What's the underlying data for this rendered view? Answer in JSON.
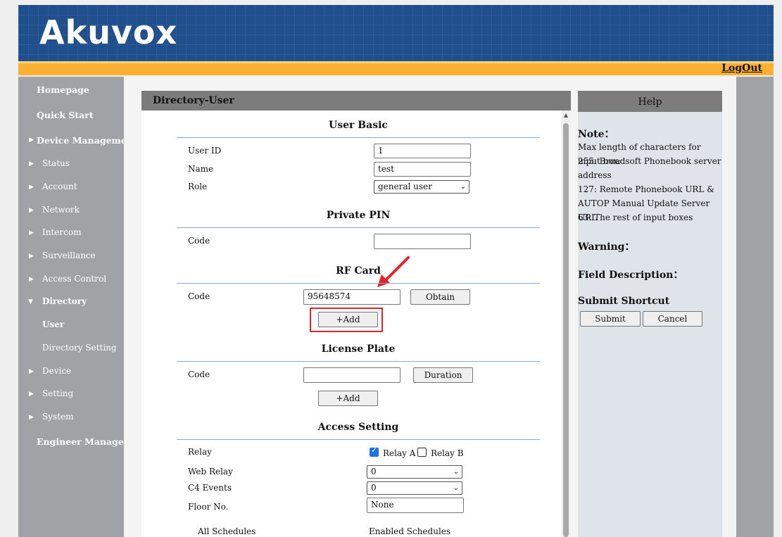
{
  "brand": {
    "logo_text": "Akuvox"
  },
  "topbar": {
    "logout_label": "LogOut"
  },
  "sidebar": {
    "homepage": "Homepage",
    "quick_start": "Quick Start",
    "device_management": "Device Management",
    "status": "Status",
    "account": "Account",
    "network": "Network",
    "intercom": "Intercom",
    "surveillance": "Surveillance",
    "access_control": "Access Control",
    "directory": "Directory",
    "user": "User",
    "directory_setting": "Directory Setting",
    "device": "Device",
    "setting": "Setting",
    "system": "System",
    "engineer": "Engineer Manage..."
  },
  "page": {
    "title": "Directory-User"
  },
  "user_basic": {
    "title": "User Basic",
    "user_id_label": "User ID",
    "user_id_value": "1",
    "name_label": "Name",
    "name_value": "test",
    "role_label": "Role",
    "role_value": "general user"
  },
  "private_pin": {
    "title": "Private PIN",
    "code_label": "Code",
    "code_value": ""
  },
  "rf_card": {
    "title": "RF Card",
    "code_label": "Code",
    "code_value": "95648574",
    "obtain_label": "Obtain",
    "add_label": "+Add"
  },
  "license_plate": {
    "title": "License Plate",
    "code_label": "Code",
    "code_value": "",
    "duration_label": "Duration",
    "add_label": "+Add"
  },
  "access_setting": {
    "title": "Access Setting",
    "relay_label": "Relay",
    "relay_a": "Relay A",
    "relay_b": "Relay B",
    "relay_a_checked": true,
    "relay_b_checked": false,
    "web_relay_label": "Web Relay",
    "web_relay_value": "0",
    "c4_label": "C4 Events",
    "c4_value": "0",
    "floor_label": "Floor No.",
    "floor_value": "None",
    "all_schedules": "All Schedules",
    "enabled_schedules": "Enabled Schedules"
  },
  "help": {
    "title": "Help",
    "note": "Note：",
    "lines": [
      "Max length of characters for input box:",
      "255: Broadsoft Phonebook server",
      "address",
      "127: Remote Phonebook URL &",
      "AUTOP Manual Update Server URL",
      "63: The rest of input boxes"
    ],
    "warning": "Warning：",
    "field_description": "Field Description：",
    "submit_shortcut": "Submit Shortcut",
    "submit_label": "Submit",
    "cancel_label": "Cancel"
  },
  "colors": {
    "header": "#1f4f8c",
    "accent": "#fbb034",
    "sidebar": "#a0a2a6",
    "highlight": "#e3232c",
    "arrow": "#e3232c"
  }
}
